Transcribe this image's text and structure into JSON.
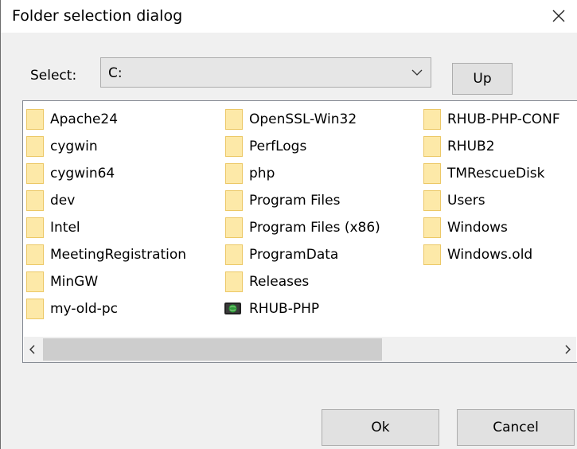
{
  "window": {
    "title": "Folder selection dialog",
    "close_symbol": "×"
  },
  "toolbar": {
    "select_label": "Select:",
    "drive_value": "C:",
    "up_label": "Up"
  },
  "folders": [
    [
      {
        "name": "Apache24",
        "icon": "folder-icon"
      },
      {
        "name": "cygwin",
        "icon": "folder-icon"
      },
      {
        "name": "cygwin64",
        "icon": "folder-icon"
      },
      {
        "name": "dev",
        "icon": "folder-icon"
      },
      {
        "name": "Intel",
        "icon": "folder-icon"
      },
      {
        "name": "MeetingRegistration",
        "icon": "folder-icon"
      },
      {
        "name": "MinGW",
        "icon": "folder-icon"
      },
      {
        "name": "my-old-pc",
        "icon": "folder-icon"
      }
    ],
    [
      {
        "name": "OpenSSL-Win32",
        "icon": "folder-icon"
      },
      {
        "name": "PerfLogs",
        "icon": "folder-icon"
      },
      {
        "name": "php",
        "icon": "folder-icon"
      },
      {
        "name": "Program Files",
        "icon": "folder-icon"
      },
      {
        "name": "Program Files (x86)",
        "icon": "folder-icon"
      },
      {
        "name": "ProgramData",
        "icon": "folder-icon"
      },
      {
        "name": "Releases",
        "icon": "folder-icon"
      },
      {
        "name": "RHUB-PHP",
        "icon": "network-drive-icon"
      }
    ],
    [
      {
        "name": "RHUB-PHP-CONF",
        "icon": "folder-icon"
      },
      {
        "name": "RHUB2",
        "icon": "folder-icon"
      },
      {
        "name": "TMRescueDisk",
        "icon": "folder-icon"
      },
      {
        "name": "Users",
        "icon": "folder-icon"
      },
      {
        "name": "Windows",
        "icon": "folder-icon"
      },
      {
        "name": "Windows.old",
        "icon": "folder-icon"
      }
    ]
  ],
  "footer": {
    "ok_label": "Ok",
    "cancel_label": "Cancel"
  },
  "scroll": {
    "left_symbol": "<",
    "right_symbol": ">",
    "thumb_position": 0
  }
}
